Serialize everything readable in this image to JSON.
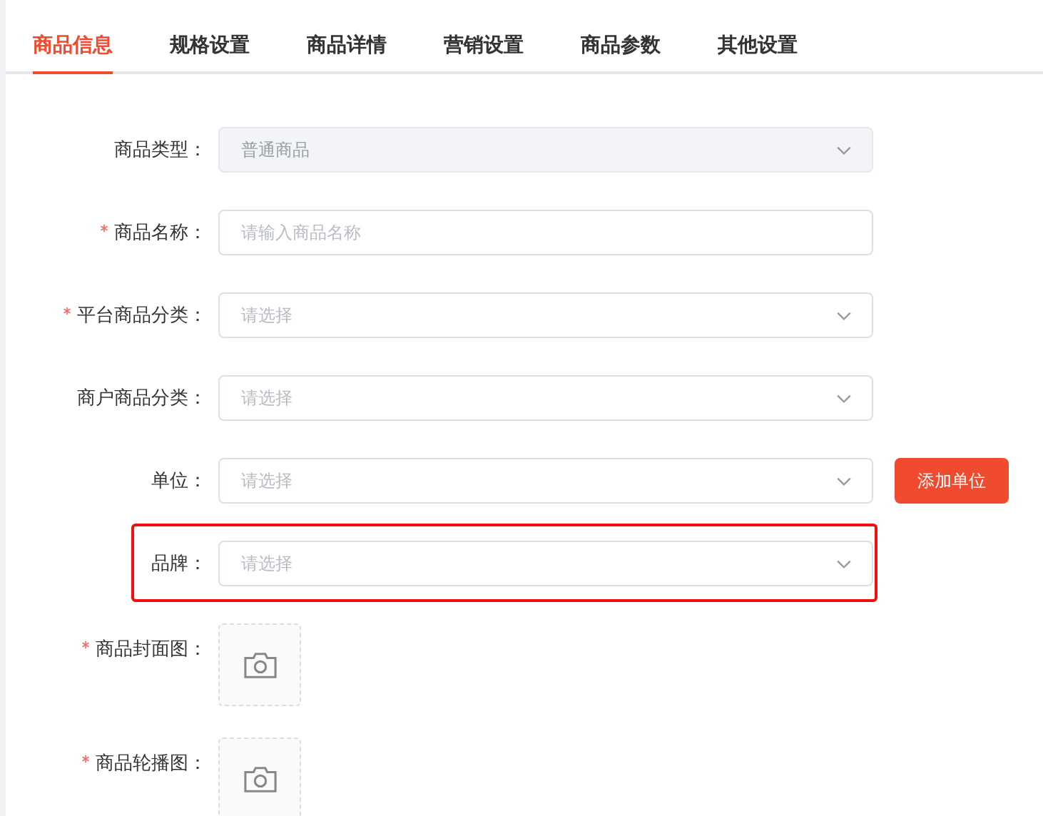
{
  "tabs": [
    {
      "label": "商品信息",
      "selected": true
    },
    {
      "label": "规格设置",
      "selected": false
    },
    {
      "label": "商品详情",
      "selected": false
    },
    {
      "label": "营销设置",
      "selected": false
    },
    {
      "label": "商品参数",
      "selected": false
    },
    {
      "label": "其他设置",
      "selected": false
    }
  ],
  "form": {
    "rows": [
      {
        "kind": "select",
        "label": "商品类型：",
        "required": false,
        "value": "普通商品",
        "disabled": true,
        "highlighted": false
      },
      {
        "kind": "input",
        "label": "商品名称：",
        "required": true,
        "placeholder": "请输入商品名称",
        "disabled": false,
        "highlighted": false
      },
      {
        "kind": "select",
        "label": "平台商品分类：",
        "required": true,
        "placeholder": "请选择",
        "disabled": false,
        "highlighted": false
      },
      {
        "kind": "select",
        "label": "商户商品分类：",
        "required": false,
        "placeholder": "请选择",
        "disabled": false,
        "highlighted": false
      },
      {
        "kind": "select",
        "label": "单位：",
        "required": false,
        "placeholder": "请选择",
        "disabled": false,
        "highlighted": false,
        "button": "添加单位"
      },
      {
        "kind": "select",
        "label": "品牌：",
        "required": false,
        "placeholder": "请选择",
        "disabled": false,
        "highlighted": true
      },
      {
        "kind": "upload",
        "label": "商品封面图：",
        "required": true
      },
      {
        "kind": "upload",
        "label": "商品轮播图：",
        "required": true
      }
    ]
  }
}
